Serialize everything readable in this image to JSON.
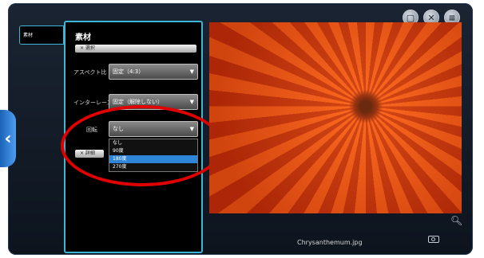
{
  "window": {
    "tab_small_label": "素材",
    "top_icons": [
      "copy-icon",
      "close-icon",
      "menu-icon"
    ]
  },
  "panel": {
    "title": "素材",
    "top_button_label": "× 選択",
    "aspect_label": "アスペクト比",
    "aspect_value": "固定（4:3）",
    "interlace_label": "インターレース",
    "interlace_value": "固定（解除しない）",
    "rotate_label": "回転",
    "rotate_value": "なし",
    "rotate_options": [
      "なし",
      "90度",
      "180度",
      "270度"
    ],
    "rotate_highlighted_index": 2,
    "bottom_button_label": "× 詳細"
  },
  "preview": {
    "filename": "Chrysanthemum.jpg"
  },
  "annotation": {
    "oval_color": "#e00000"
  }
}
